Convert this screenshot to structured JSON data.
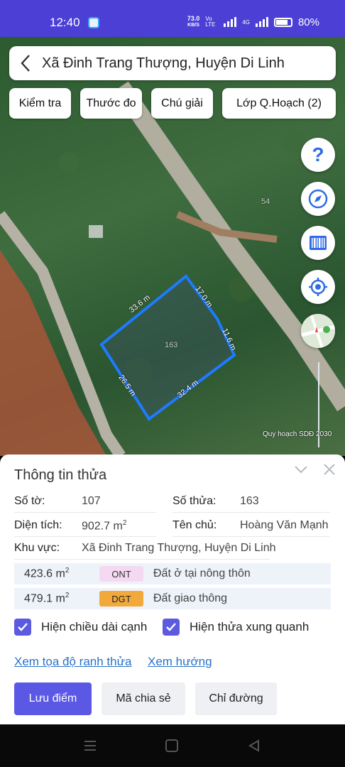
{
  "status_bar": {
    "time": "12:40",
    "speed_value": "73.0",
    "speed_unit": "KB/S",
    "volte": "Vo LTE",
    "network": "4G",
    "battery": "80%"
  },
  "header": {
    "back_icon": "chevron-left-icon",
    "title": "Xã Đinh Trang Thượng, Huyện Di Linh"
  },
  "toolbar": {
    "check_label": "Kiểm tra",
    "measure_label": "Thước đo",
    "legend_label": "Chú giải",
    "layer_label": "Lớp Q.Hoạch (2)"
  },
  "map_tools": {
    "help_icon": "question-icon",
    "compass_icon": "compass-icon",
    "barcode_icon": "barcode-icon",
    "locate_icon": "locate-icon",
    "basemap_icon": "map-thumbnail-icon"
  },
  "map": {
    "edge_labels": [
      "33.6 m",
      "17.0 m",
      "11.6 m",
      "32.4 m",
      "26.5 m"
    ],
    "parcel_number": "163",
    "neighbor_number": "54",
    "planning_caption": "Quy hoạch SDĐ 2030",
    "parcel_color": "#1e7bff",
    "road_color": "#a8a49a"
  },
  "panel": {
    "title": "Thông tin thửa",
    "collapse_icon": "chevron-down-icon",
    "close_icon": "close-icon",
    "sheet_label": "Số tờ:",
    "sheet_value": "107",
    "parcel_label": "Số thửa:",
    "parcel_value": "163",
    "area_label": "Diện tích:",
    "area_value": "902.7 m",
    "area_unit_sup": "2",
    "owner_label": "Tên chủ:",
    "owner_value": "Hoàng Văn Mạnh",
    "region_label": "Khu vực:",
    "region_value": "Xã Đinh Trang Thượng, Huyện Di Linh",
    "land_uses": [
      {
        "area": "423.6 m",
        "sup": "2",
        "code": "ONT",
        "name": "Đất ở tại nông thôn",
        "badge_bg": "#f5d9f2",
        "badge_color": "#333333"
      },
      {
        "area": "479.1 m",
        "sup": "2",
        "code": "DGT",
        "name": "Đất giao thông",
        "badge_bg": "#f2a93b",
        "badge_color": "#222222"
      }
    ],
    "show_edge_lengths": "Hiện chiều dài cạnh",
    "show_neighbors": "Hiện thửa xung quanh",
    "view_coords_link": "Xem tọa độ ranh thửa",
    "view_direction_link": "Xem hướng",
    "save_point_button": "Lưu điểm",
    "share_code_button": "Mã chia sẻ",
    "directions_button": "Chỉ đường"
  },
  "nav": {
    "menu_icon": "recent-apps-icon",
    "home_icon": "home-icon",
    "back_icon": "back-triangle-icon"
  }
}
